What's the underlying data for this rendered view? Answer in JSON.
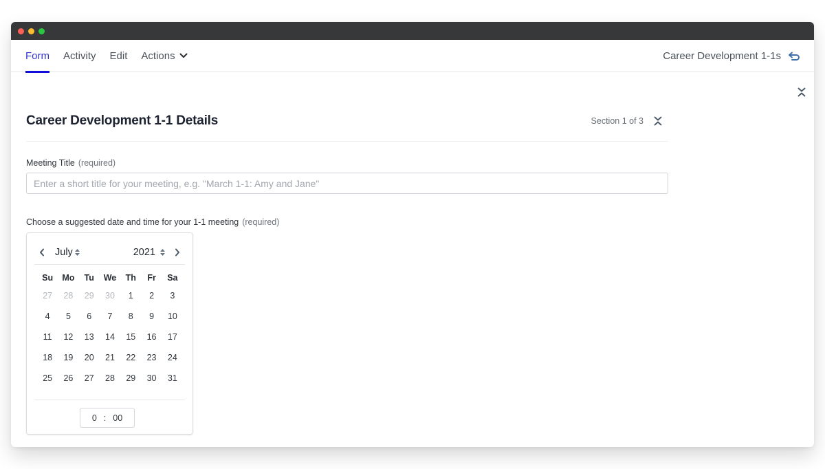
{
  "window": {
    "traffic_lights": [
      {
        "name": "close",
        "color": "#ff5f57"
      },
      {
        "name": "minimize",
        "color": "#febc2e"
      },
      {
        "name": "zoom",
        "color": "#28c840"
      }
    ]
  },
  "nav": {
    "tabs": [
      {
        "label": "Form",
        "active": true
      },
      {
        "label": "Activity",
        "active": false
      },
      {
        "label": "Edit",
        "active": false
      },
      {
        "label": "Actions",
        "active": false,
        "has_dropdown": true
      }
    ],
    "right_label": "Career Development 1-1s",
    "right_icon": "return-arrow-icon",
    "accent_color": "#1010d8"
  },
  "collapse_all_icon": "collapse-chevrons-icon",
  "section": {
    "title": "Career Development 1-1 Details",
    "progress_label": "Section 1 of 3",
    "collapse_icon": "collapse-chevrons-icon"
  },
  "fields": {
    "meeting_title": {
      "label": "Meeting Title",
      "required_label": "(required)",
      "value": "",
      "placeholder": "Enter a short title for your meeting, e.g. \"March 1-1: Amy and Jane\""
    },
    "date_time": {
      "label": "Choose a suggested date and time for your 1-1 meeting",
      "required_label": "(required)"
    }
  },
  "calendar": {
    "month": "July",
    "year": "2021",
    "prev_icon": "chevron-left-icon",
    "next_icon": "chevron-right-icon",
    "weekdays": [
      "Su",
      "Mo",
      "Tu",
      "We",
      "Th",
      "Fr",
      "Sa"
    ],
    "days": [
      {
        "d": "27",
        "muted": true
      },
      {
        "d": "28",
        "muted": true
      },
      {
        "d": "29",
        "muted": true
      },
      {
        "d": "30",
        "muted": true
      },
      {
        "d": "1"
      },
      {
        "d": "2"
      },
      {
        "d": "3"
      },
      {
        "d": "4"
      },
      {
        "d": "5"
      },
      {
        "d": "6"
      },
      {
        "d": "7"
      },
      {
        "d": "8"
      },
      {
        "d": "9"
      },
      {
        "d": "10"
      },
      {
        "d": "11"
      },
      {
        "d": "12"
      },
      {
        "d": "13"
      },
      {
        "d": "14"
      },
      {
        "d": "15"
      },
      {
        "d": "16"
      },
      {
        "d": "17"
      },
      {
        "d": "18"
      },
      {
        "d": "19"
      },
      {
        "d": "20"
      },
      {
        "d": "21"
      },
      {
        "d": "22"
      },
      {
        "d": "23"
      },
      {
        "d": "24"
      },
      {
        "d": "25"
      },
      {
        "d": "26"
      },
      {
        "d": "27"
      },
      {
        "d": "28"
      },
      {
        "d": "29"
      },
      {
        "d": "30"
      },
      {
        "d": "31"
      }
    ],
    "time": {
      "hour": "0",
      "separator": ":",
      "minute": "00"
    }
  }
}
